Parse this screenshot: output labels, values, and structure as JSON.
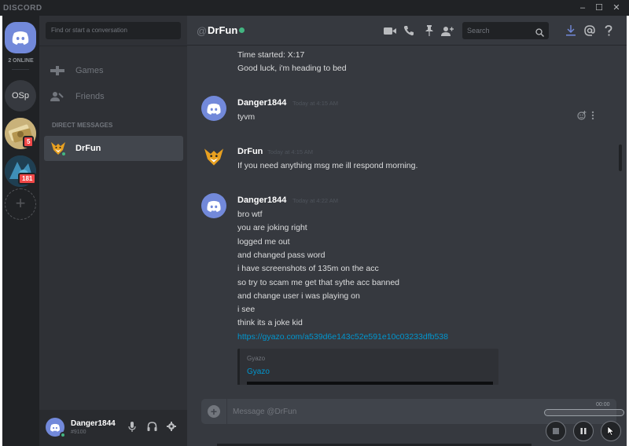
{
  "window": {
    "brand": "DISCORD",
    "controls": [
      "–",
      "☐",
      "✕"
    ]
  },
  "guilds": {
    "online_label": "2 ONLINE",
    "osp_label": "OSp",
    "badges": [
      "5",
      "181"
    ],
    "add_label": "+"
  },
  "sidebar": {
    "search_placeholder": "Find or start a conversation",
    "nav": [
      {
        "label": "Games",
        "icon": "gamepad-icon"
      },
      {
        "label": "Friends",
        "icon": "friends-icon"
      }
    ],
    "dm_header": "DIRECT MESSAGES",
    "dms": [
      {
        "name": "DrFun",
        "status": "online"
      }
    ]
  },
  "user_panel": {
    "username": "Danger1844",
    "tag": "#9100"
  },
  "header": {
    "at": "@",
    "channel": "DrFun",
    "search_placeholder": "Search"
  },
  "messages": {
    "top_lines": [
      "Time started: X:17",
      "Good luck, i'm heading to bed"
    ],
    "groups": [
      {
        "author": "Danger1844",
        "timestamp": "Today at 4:15 AM",
        "lines": [
          "tyvm"
        ]
      },
      {
        "author": "DrFun",
        "timestamp": "Today at 4:15 AM",
        "lines": [
          "If you need anything msg me ill respond morning."
        ]
      },
      {
        "author": "Danger1844",
        "timestamp": "Today at 4:22 AM",
        "lines": [
          "bro wtf",
          "you are joking right",
          "logged me out",
          "and changed pass word",
          "i have screenshots of 135m on the acc",
          "so try to scam me get that sythe acc banned",
          "and change user i was playing on",
          "i see",
          "think its a joke kid"
        ],
        "link": "https://gyazo.com/a539d6e143c52e591e10c03233dfb538",
        "embed": {
          "provider": "Gyazo",
          "title": "Gyazo"
        }
      }
    ]
  },
  "composer": {
    "placeholder": "Message @DrFun"
  },
  "overlay": {
    "time": "00:00"
  },
  "colors": {
    "blurple": "#7289da",
    "online": "#43b581",
    "badge": "#f04747",
    "link": "#0096cf"
  }
}
